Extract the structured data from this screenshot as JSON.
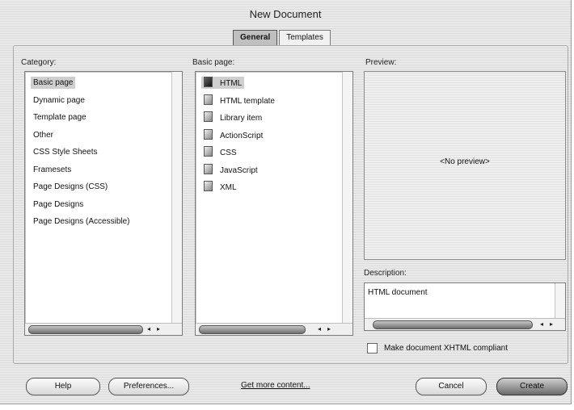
{
  "window": {
    "title": "New Document"
  },
  "tabs": [
    {
      "label": "General",
      "active": true
    },
    {
      "label": "Templates",
      "active": false
    }
  ],
  "category": {
    "label": "Category:",
    "items": [
      "Basic page",
      "Dynamic page",
      "Template page",
      "Other",
      "CSS Style Sheets",
      "Framesets",
      "Page Designs (CSS)",
      "Page Designs",
      "Page Designs (Accessible)"
    ],
    "selected": "Basic page"
  },
  "basic_page": {
    "label": "Basic page:",
    "items": [
      "HTML",
      "HTML template",
      "Library item",
      "ActionScript",
      "CSS",
      "JavaScript",
      "XML"
    ],
    "selected": "HTML"
  },
  "preview": {
    "label": "Preview:",
    "placeholder": "<No preview>"
  },
  "description": {
    "label": "Description:",
    "text": "HTML document"
  },
  "xhtml_checkbox": {
    "label": "Make document XHTML compliant",
    "checked": false
  },
  "buttons": {
    "help": "Help",
    "preferences": "Preferences...",
    "get_more": "Get more content...",
    "cancel": "Cancel",
    "create": "Create"
  },
  "scroll_arrows": {
    "left": "◂",
    "right": "▸"
  },
  "colors": {
    "dialog_bg": "#e6e6e6",
    "selection": "#cfcfcf",
    "default_button": "#6a6a6a"
  }
}
